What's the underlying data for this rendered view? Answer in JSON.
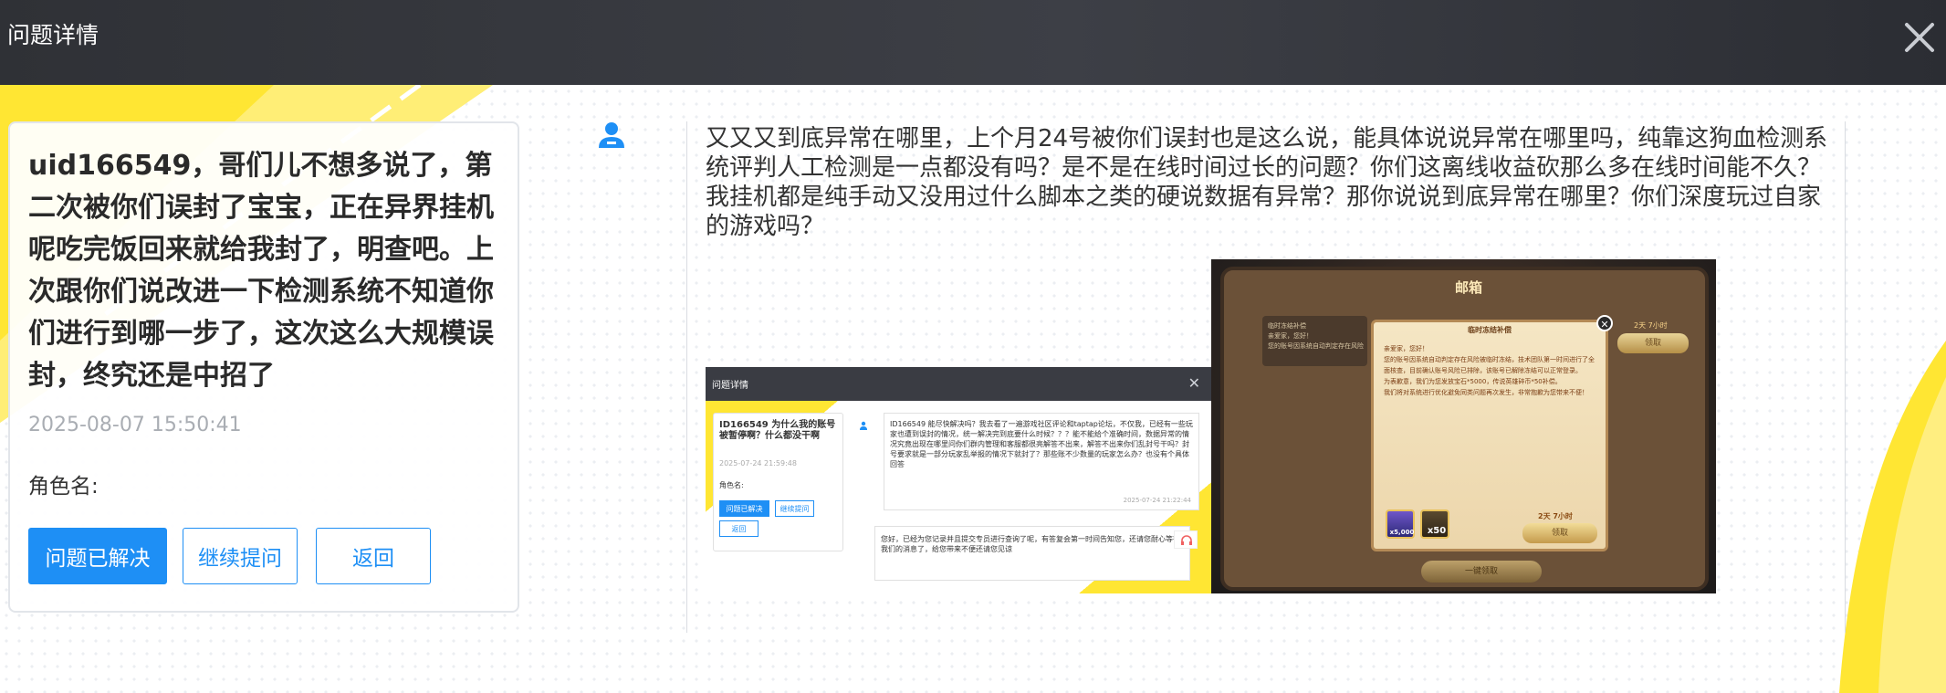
{
  "header": {
    "title": "问题详情",
    "close_label": "✕"
  },
  "question": {
    "title": "uid166549，哥们儿不想多说了，第二次被你们误封了宝宝，正在异界挂机呢吃完饭回来就给我封了，明查吧。上次跟你们说改进一下检测系统不知道你们进行到哪一步了，这次这么大规模误封，终究还是中招了",
    "time": "2025-08-07 15:50:41",
    "role_label": "角色名:",
    "buttons": {
      "resolved": "问题已解决",
      "continue": "继续提问",
      "back": "返回"
    }
  },
  "message": {
    "text": "又又又到底异常在哪里，上个月24号被你们误封也是这么说，能具体说说异常在哪里吗，纯靠这狗血检测系统评判人工检测是一点都没有吗？是不是在线时间过长的问题？你们这离线收益砍那么多在线时间能不久？我挂机都是纯手动又没用过什么脚本之类的硬说数据有异常？那你说说到底异常在哪里？你们深度玩过自家的游戏吗？"
  },
  "attachment1": {
    "header_title": "问题详情",
    "card_title": "ID166549 为什么我的账号被暂停啊？什么都没干啊",
    "card_time": "2025-07-24 21:59:48",
    "role_label": "角色名:",
    "btn_resolved": "问题已解决",
    "btn_continue": "继续提问",
    "btn_back": "返回",
    "msg_text": "ID166549 能尽快解决吗？我去看了一遍游戏社区评论和taptap论坛，不仅我，已经有一些玩家也遭到误封的情况，统一解决完到底要什么时候？？？能不能给个准确时间，数据异常的情况究竟出现在哪里问你们群内管理和客服都很亮解答不出来，解答不出来你们乱封号干吗？封号要求就是一部分玩家乱举报的情况下就封了？那些账不少数量的玩家怎么办？也没有个具体回答",
    "msg_time": "2025-07-24 21:22:44",
    "reply_text": "您好，已经为您记录并且提交专员进行查询了呢，有答复会第一时间告知您，还请您耐心等待我们的消息了，给您带来不便还请您见谅"
  },
  "attachment2": {
    "title": "邮箱",
    "list_text": "临时冻结补偿\n亲爱家，您好！\n您的账号因系统自动判定存在风险",
    "right_time": "2天 7小时",
    "right_btn": "领取",
    "dialog_title": "临时冻结补偿",
    "dialog_text": "亲爱家，您好！\n您的账号因系统自动判定存在风险被临时冻结，技术团队第一时间进行了全面核查，目前确认账号风险已排除，该账号已解除冻结可以正常登录。\n为表歉意，我们为您发放宝石*5000，传说英雄碎币*50补偿。\n我们将对系统进行优化避免同类问题再次发生，非常抱歉为您带来不便！",
    "item1_qty": "x5,000",
    "item2_qty": "x50",
    "dialog_time": "2天 7小时",
    "dialog_btn": "领取",
    "bottom_btn": "一键领取"
  },
  "colors": {
    "primary": "#1e8ff5",
    "header_bg": "#2f3136",
    "accent_yellow": "#ffe633"
  }
}
